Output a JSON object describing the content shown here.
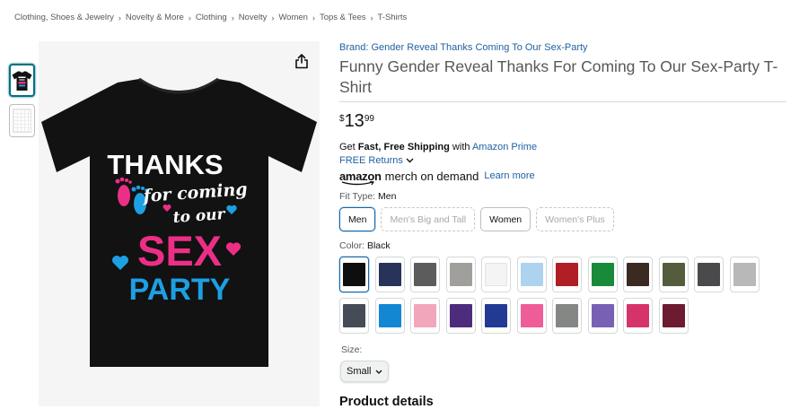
{
  "breadcrumb": [
    "Clothing, Shoes & Jewelry",
    "Novelty & More",
    "Clothing",
    "Novelty",
    "Women",
    "Tops & Tees",
    "T-Shirts"
  ],
  "breadcrumb_separator": "›",
  "thumbnails": [
    {
      "name": "shirt-front",
      "active": true
    },
    {
      "name": "size-chart",
      "active": false
    }
  ],
  "shirt_print": {
    "line1": "THANKS",
    "line2": "for coming",
    "line3": "to our",
    "line4": "SEX",
    "line5": "PARTY",
    "colors": {
      "shirt": "#121212",
      "white": "#ffffff",
      "pink": "#ec2f86",
      "blue": "#1d9fe3"
    }
  },
  "product": {
    "brand_link": "Brand: Gender Reveal Thanks Coming To Our Sex-Party",
    "title": "Funny Gender Reveal Thanks For Coming To Our Sex-Party T-Shirt",
    "price": {
      "symbol": "$",
      "whole": "13",
      "fraction": "99"
    }
  },
  "shipping": {
    "prefix": "Get ",
    "bold": "Fast, Free Shipping",
    "middle": " with ",
    "link": "Amazon Prime",
    "returns": "FREE Returns"
  },
  "merch": {
    "amazon": "amazon",
    "merch_text": "merch on demand",
    "learn_more": "Learn more"
  },
  "fit_type": {
    "label": "Fit Type: ",
    "value": "Men",
    "options": [
      {
        "label": "Men",
        "state": "selected"
      },
      {
        "label": "Men's Big and Tall",
        "state": "unavailable"
      },
      {
        "label": "Women",
        "state": "available"
      },
      {
        "label": "Women's Plus",
        "state": "unavailable"
      }
    ]
  },
  "color": {
    "label": "Color: ",
    "value": "Black",
    "swatches": [
      {
        "hex": "#0e0e0e",
        "selected": true
      },
      {
        "hex": "#28335a"
      },
      {
        "hex": "#5c5c5c"
      },
      {
        "hex": "#a19f9c"
      },
      {
        "hex": "#f4f4f4"
      },
      {
        "hex": "#aed3ee"
      },
      {
        "hex": "#b11e23"
      },
      {
        "hex": "#198a3a"
      },
      {
        "hex": "#3a2a22"
      },
      {
        "hex": "#535d3d"
      },
      {
        "hex": "#4a4a4c"
      },
      {
        "hex": "#b8b8b8"
      },
      {
        "hex": "#464c57"
      },
      {
        "hex": "#1387d3"
      },
      {
        "hex": "#f2a6bb"
      },
      {
        "hex": "#4d2c7c"
      },
      {
        "hex": "#233a94"
      },
      {
        "hex": "#ef5d98"
      },
      {
        "hex": "#858784"
      },
      {
        "hex": "#7861b4"
      },
      {
        "hex": "#d7336b"
      },
      {
        "hex": "#6c1b30"
      }
    ]
  },
  "size": {
    "label": "Size:",
    "value": "Small"
  },
  "product_details_heading": "Product details",
  "accent_colors": {
    "link": "#2162a1",
    "selected_border": "#2162a1",
    "price": "#0f1111"
  }
}
